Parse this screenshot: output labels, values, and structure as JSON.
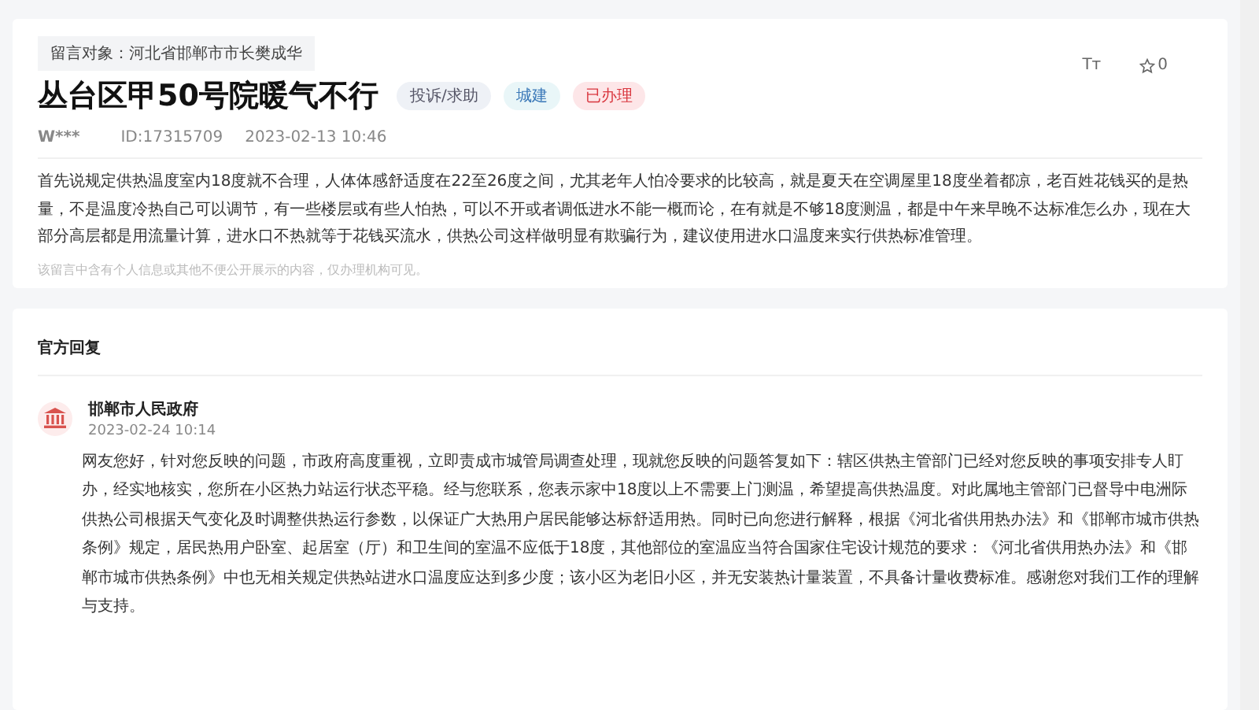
{
  "post": {
    "target": "留言对象：河北省邯郸市市长樊成华",
    "title": "丛台区甲50号院暖气不行",
    "tags": [
      {
        "label": "投诉/求助",
        "kind": "type"
      },
      {
        "label": "城建",
        "kind": "field"
      },
      {
        "label": "已办理",
        "kind": "status"
      }
    ],
    "author": "W***",
    "id": "ID:17315709",
    "time": "2023-02-13 10:46",
    "font_button": "Tт",
    "favorites": "0",
    "body": "首先说规定供热温度室内18度就不合理，人体体感舒适度在22至26度之间，尤其老年人怕冷要求的比较高，就是夏天在空调屋里18度坐着都凉，老百姓花钱买的是热量，不是温度冷热自己可以调节，有一些楼层或有些人怕热，可以不开或者调低进水不能一概而论，在有就是不够18度测温，都是中午来早晚不达标准怎么办，现在大部分高层都是用流量计算，进水口不热就等于花钱买流水，供热公司这样做明显有欺骗行为，建议使用进水口温度来实行供热标准管理。",
    "notice": "该留言中含有个人信息或其他不便公开展示的内容，仅办理机构可见。"
  },
  "reply": {
    "heading": "官方回复",
    "org": "邯郸市人民政府",
    "time": "2023-02-24 10:14",
    "body": "网友您好，针对您反映的问题，市政府高度重视，立即责成市城管局调查处理，现就您反映的问题答复如下：辖区供热主管部门已经对您反映的事项安排专人盯办，经实地核实，您所在小区热力站运行状态平稳。经与您联系，您表示家中18度以上不需要上门测温，希望提高供热温度。对此属地主管部门已督导中电洲际供热公司根据天气变化及时调整供热运行参数，以保证广大热用户居民能够达标舒适用热。同时已向您进行解释，根据《河北省供用热办法》和《邯郸市城市供热条例》规定，居民热用户卧室、起居室（厅）和卫生间的室温不应低于18度，其他部位的室温应当符合国家住宅设计规范的要求：《河北省供用热办法》和《邯郸市城市供热条例》中也无相关规定供热站进水口温度应达到多少度；该小区为老旧小区，并无安装热计量装置，不具备计量收费标准。感谢您对我们工作的理解与支持。"
  }
}
